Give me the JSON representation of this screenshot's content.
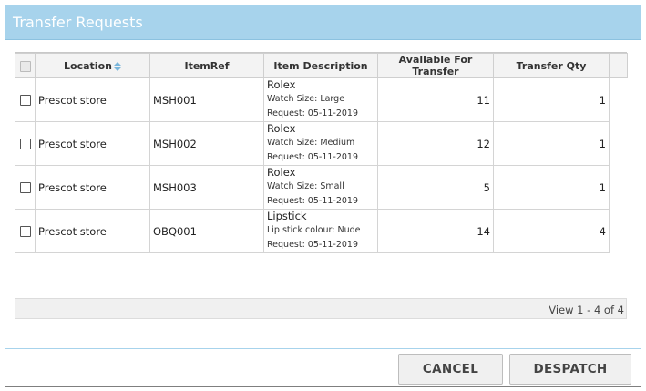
{
  "dialog": {
    "title": "Transfer Requests",
    "title_bar_color": "#a7d3ec"
  },
  "grid": {
    "columns": {
      "location": "Location",
      "item_ref": "ItemRef",
      "item_description": "Item Description",
      "available": "Available For Transfer",
      "transfer_qty": "Transfer Qty"
    },
    "sort": {
      "column": "location",
      "icon": "sort-icon"
    },
    "rows": [
      {
        "location": "Prescot store",
        "item_ref": "MSH001",
        "desc_name": "Rolex",
        "desc_attr": "Watch Size: Large",
        "desc_request": "Request: 05-11-2019",
        "available": "11",
        "transfer_qty": "1"
      },
      {
        "location": "Prescot store",
        "item_ref": "MSH002",
        "desc_name": "Rolex",
        "desc_attr": "Watch Size: Medium",
        "desc_request": "Request: 05-11-2019",
        "available": "12",
        "transfer_qty": "1"
      },
      {
        "location": "Prescot store",
        "item_ref": "MSH003",
        "desc_name": "Rolex",
        "desc_attr": "Watch Size: Small",
        "desc_request": "Request: 05-11-2019",
        "available": "5",
        "transfer_qty": "1"
      },
      {
        "location": "Prescot store",
        "item_ref": "OBQ001",
        "desc_name": "Lipstick",
        "desc_attr": "Lip stick colour: Nude",
        "desc_request": "Request: 05-11-2019",
        "available": "14",
        "transfer_qty": "4"
      }
    ],
    "pager_text": "View 1 - 4 of 4"
  },
  "buttons": {
    "cancel": "CANCEL",
    "despatch": "DESPATCH"
  }
}
